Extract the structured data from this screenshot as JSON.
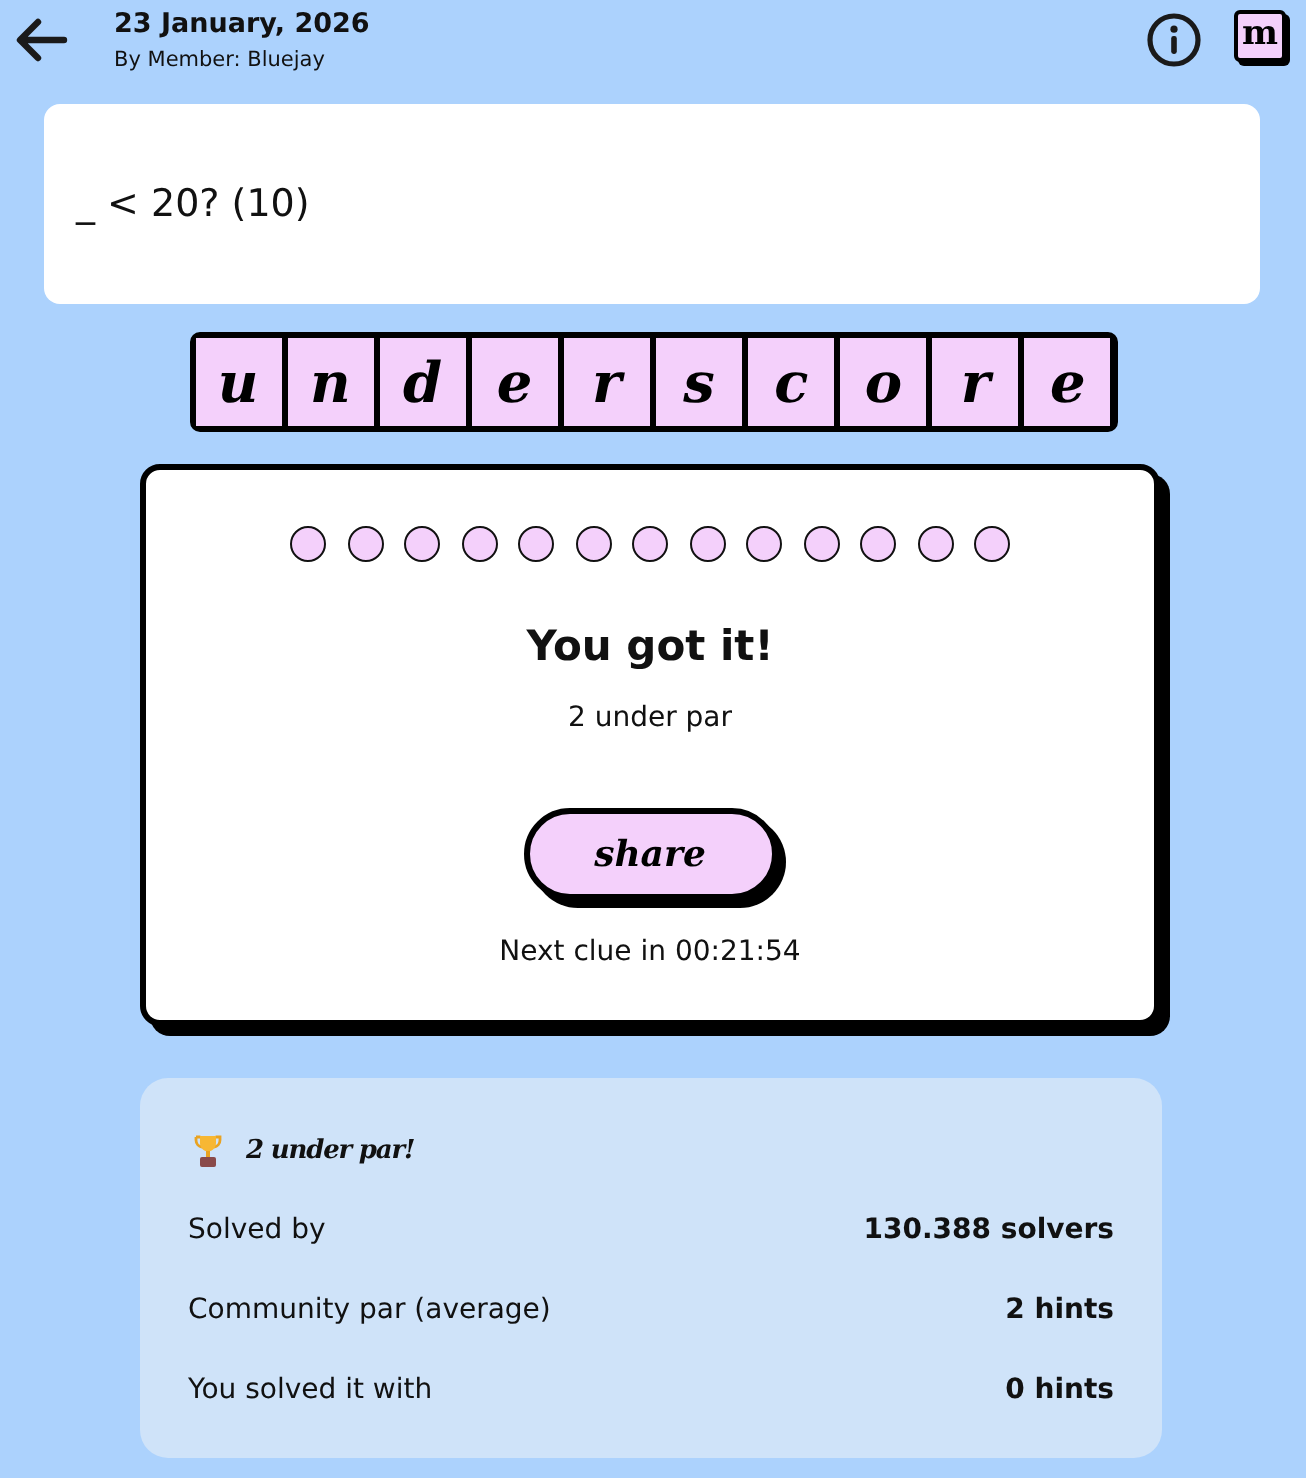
{
  "header": {
    "date": "23 January, 2026",
    "byline": "By Member: Bluejay",
    "logo_letter": "m"
  },
  "clue": {
    "text": "_ < 20? (10)"
  },
  "answer_tiles": [
    "u",
    "n",
    "d",
    "e",
    "r",
    "s",
    "c",
    "o",
    "r",
    "e"
  ],
  "result": {
    "hint_dots": [
      {
        "filled": true
      },
      {
        "filled": true
      },
      {
        "filled": true
      },
      {
        "filled": true
      },
      {
        "filled": true
      },
      {
        "filled": true
      },
      {
        "filled": true
      },
      {
        "filled": true
      },
      {
        "filled": true
      },
      {
        "filled": true
      },
      {
        "filled": true
      },
      {
        "filled": true
      },
      {
        "filled": true
      }
    ],
    "title": "You got it!",
    "subtitle": "2 under par",
    "share_button": "share",
    "countdown": "Next clue in 00:21:54"
  },
  "stats": {
    "headline": "2 under par!",
    "rows": [
      {
        "label": "Solved by",
        "value": "130.388 solvers"
      },
      {
        "label": "Community par (average)",
        "value": "2 hints"
      },
      {
        "label": "You solved it with",
        "value": "0 hints"
      }
    ]
  }
}
